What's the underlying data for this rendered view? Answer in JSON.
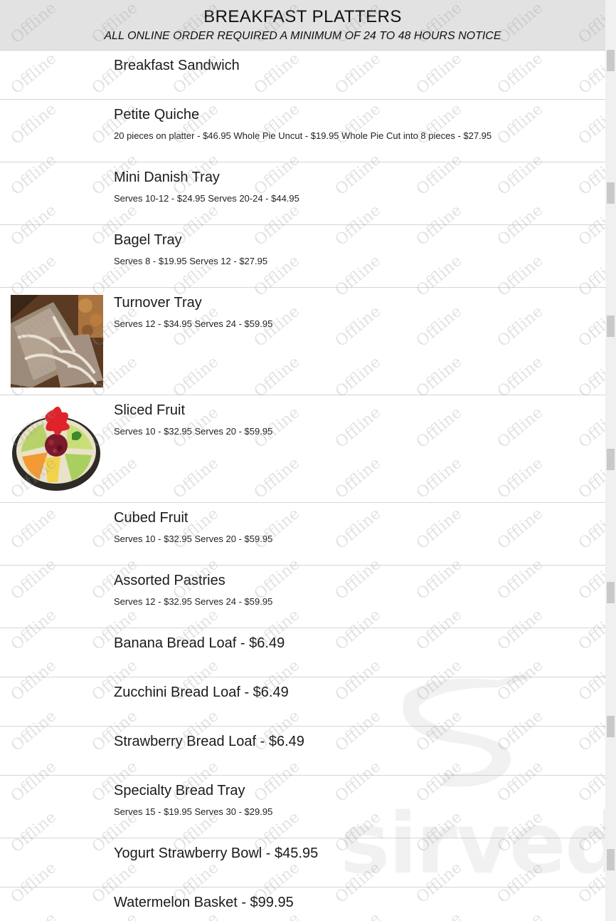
{
  "header": {
    "title": "BREAKFAST PLATTERS",
    "subtitle": "ALL ONLINE ORDER REQUIRED A MINIMUM OF 24 TO 48 HOURS NOTICE"
  },
  "items": [
    {
      "name": "Breakfast Sandwich",
      "desc": ""
    },
    {
      "name": "Petite Quiche",
      "desc": "20 pieces on platter - $46.95 Whole Pie Uncut - $19.95 Whole Pie Cut into 8 pieces - $27.95"
    },
    {
      "name": "Mini Danish Tray",
      "desc": "Serves 10-12 - $24.95 Serves 20-24 - $44.95"
    },
    {
      "name": "Bagel Tray",
      "desc": "Serves 8 - $19.95 Serves 12 - $27.95"
    },
    {
      "name": "Turnover Tray",
      "desc": "Serves 12 - $34.95 Serves 24 - $59.95",
      "image": "turnover-pastry-photo"
    },
    {
      "name": "Sliced Fruit",
      "desc": "Serves 10 - $32.95 Serves 20 - $59.95",
      "image": "fruit-platter-photo"
    },
    {
      "name": "Cubed Fruit",
      "desc": "Serves 10 - $32.95 Serves 20 - $59.95"
    },
    {
      "name": "Assorted Pastries",
      "desc": "Serves 12 - $32.95 Serves 24 - $59.95"
    },
    {
      "name": "Banana Bread Loaf - $6.49",
      "desc": ""
    },
    {
      "name": "Zucchini Bread Loaf - $6.49",
      "desc": ""
    },
    {
      "name": "Strawberry Bread Loaf - $6.49",
      "desc": ""
    },
    {
      "name": "Specialty Bread Tray",
      "desc": "Serves 15 - $19.95 Serves 30 - $29.95"
    },
    {
      "name": "Yogurt Strawberry Bowl - $45.95",
      "desc": ""
    },
    {
      "name": "Watermelon Basket - $99.95",
      "desc": ""
    }
  ],
  "watermark": {
    "text": "Offline",
    "brand": "sirved"
  }
}
